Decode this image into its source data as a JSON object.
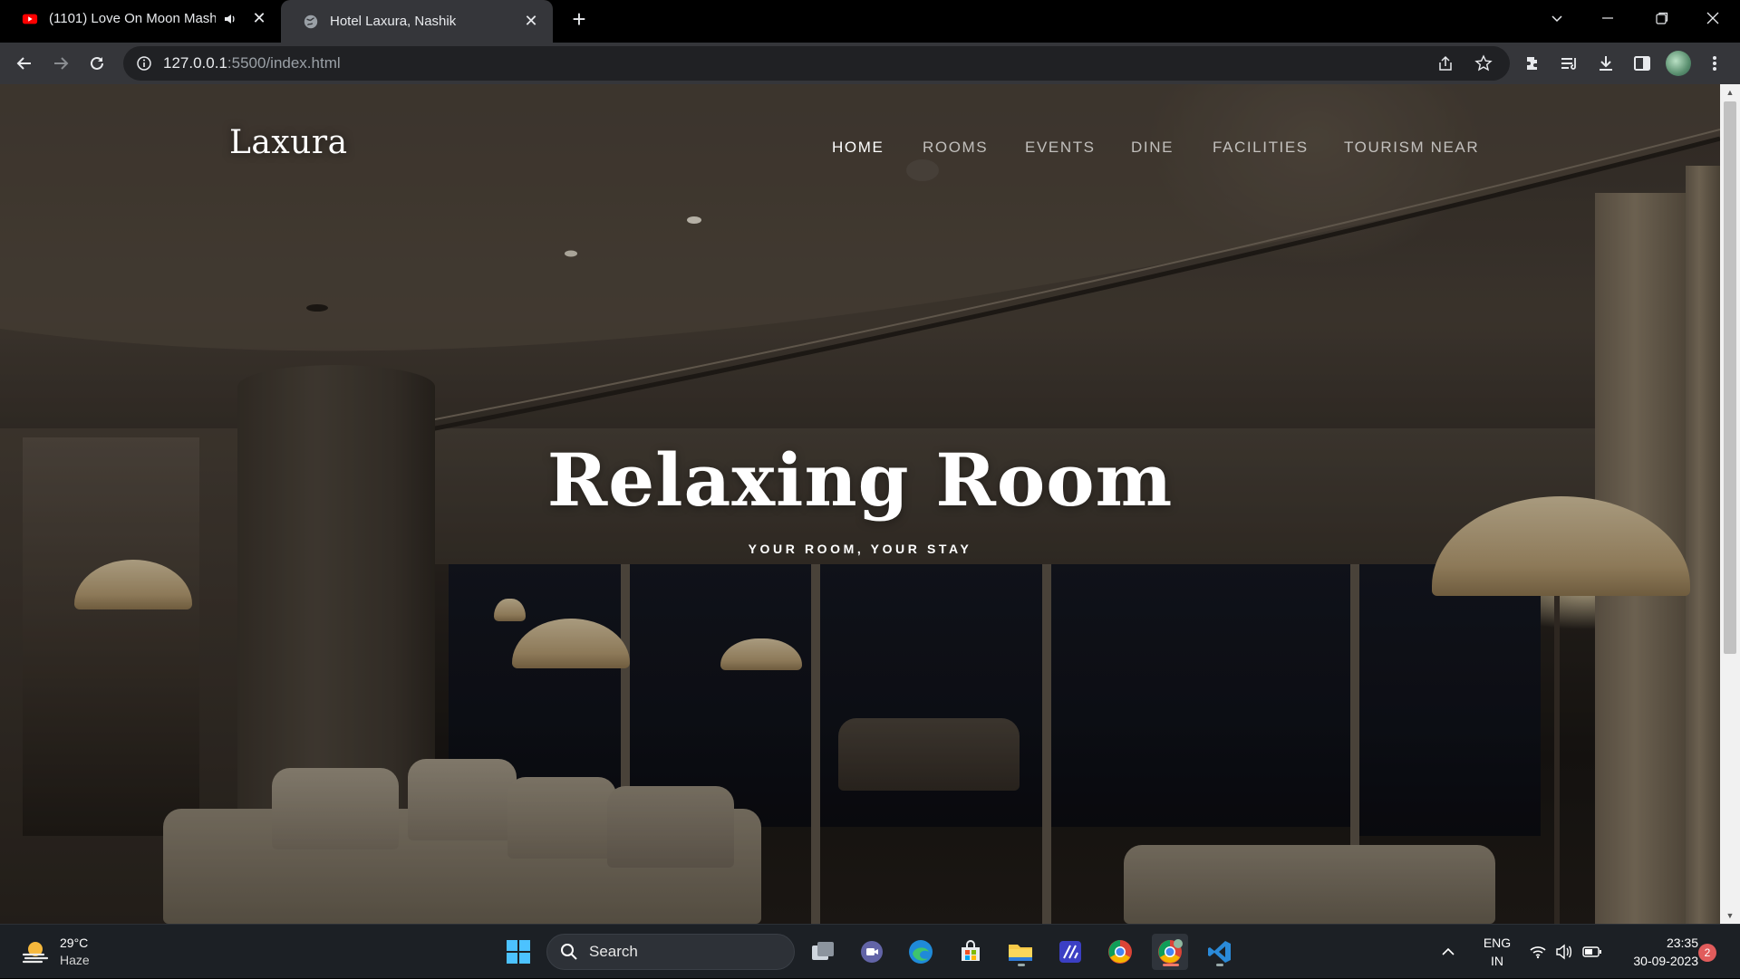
{
  "browser": {
    "tabs": [
      {
        "title": "(1101) Love On Moon Mash",
        "favicon": "youtube-icon",
        "audio": true,
        "active": false
      },
      {
        "title": "Hotel Laxura, Nashik",
        "favicon": "globe-icon",
        "active": true
      }
    ],
    "url_host": "127.0.0.1",
    "url_path": ":5500/index.html"
  },
  "page": {
    "logo": "Laxura",
    "nav": [
      {
        "label": "HOME",
        "active": true
      },
      {
        "label": "ROOMS",
        "active": false
      },
      {
        "label": "EVENTS",
        "active": false
      },
      {
        "label": "DINE",
        "active": false
      },
      {
        "label": "FACILITIES",
        "active": false
      },
      {
        "label": "TOURISM NEAR",
        "active": false
      }
    ],
    "hero_title": "Relaxing Room",
    "hero_subtitle": "YOUR ROOM, YOUR STAY"
  },
  "taskbar": {
    "weather_temp": "29°C",
    "weather_condition": "Haze",
    "search_label": "Search",
    "lang_line1": "ENG",
    "lang_line2": "IN",
    "time": "23:35",
    "date": "30-09-2023",
    "notification_count": "2",
    "pinned": [
      "task-view-icon",
      "teams-meet-icon",
      "edge-icon",
      "store-icon",
      "file-explorer-icon",
      "ai-app-icon",
      "chrome-icon",
      "chrome-profile-icon",
      "vscode-icon"
    ]
  },
  "colors": {
    "tab_active": "#35363a",
    "toolbar": "#35363a",
    "omnibox": "#202124",
    "taskbar": "#1c2025",
    "notification_badge": "#e15c5c"
  }
}
